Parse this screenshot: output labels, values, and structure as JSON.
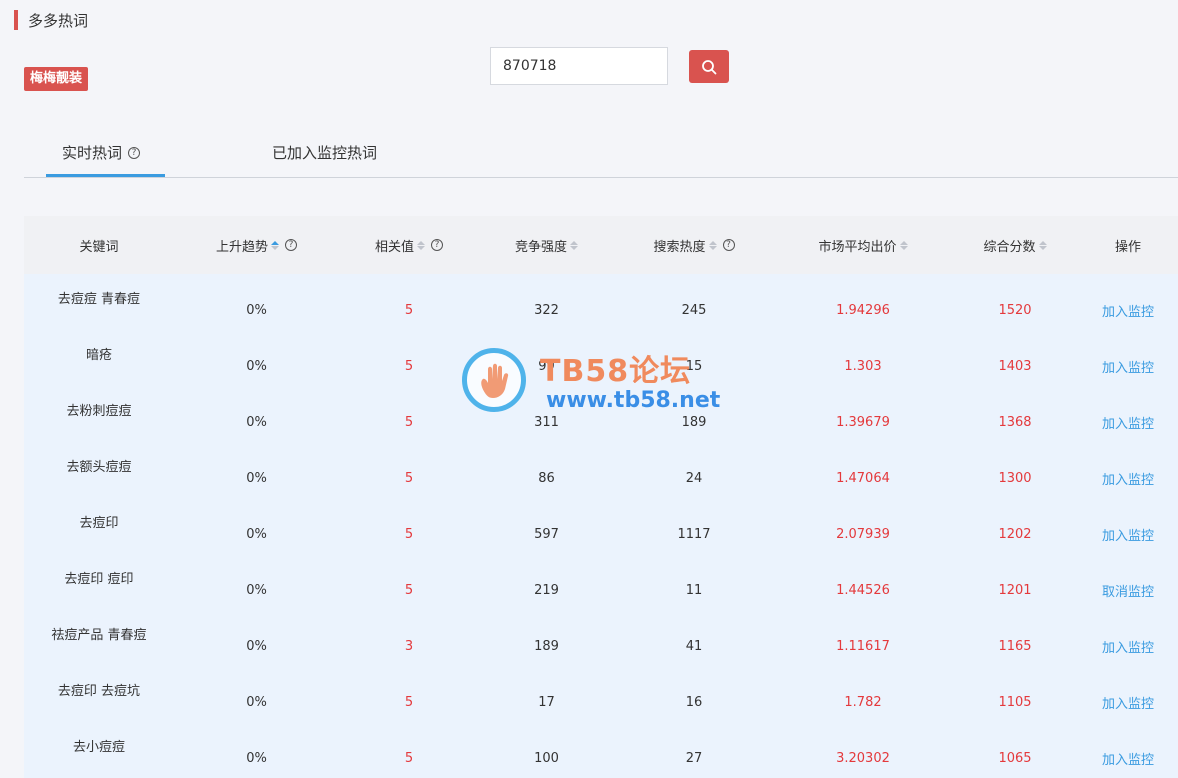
{
  "header": {
    "title": "多多热词"
  },
  "shop": {
    "name": "梅梅靓装"
  },
  "search": {
    "value": "870718"
  },
  "tabs": [
    {
      "label": "实时热词",
      "active": true
    },
    {
      "label": "已加入监控热词",
      "active": false
    }
  ],
  "table": {
    "headers": [
      "关键词",
      "上升趋势",
      "相关值",
      "竞争强度",
      "搜索热度",
      "市场平均出价",
      "综合分数",
      "操作"
    ],
    "rows": [
      {
        "keyword": "去痘痘 青春痘",
        "trend": "0%",
        "relevance": "5",
        "competition": "322",
        "heat": "245",
        "avg_bid": "1.94296",
        "score": "1520",
        "action": "加入监控"
      },
      {
        "keyword": "暗疮",
        "trend": "0%",
        "relevance": "5",
        "competition": "99",
        "heat": "15",
        "avg_bid": "1.303",
        "score": "1403",
        "action": "加入监控"
      },
      {
        "keyword": "去粉刺痘痘",
        "trend": "0%",
        "relevance": "5",
        "competition": "311",
        "heat": "189",
        "avg_bid": "1.39679",
        "score": "1368",
        "action": "加入监控"
      },
      {
        "keyword": "去额头痘痘",
        "trend": "0%",
        "relevance": "5",
        "competition": "86",
        "heat": "24",
        "avg_bid": "1.47064",
        "score": "1300",
        "action": "加入监控"
      },
      {
        "keyword": "去痘印",
        "trend": "0%",
        "relevance": "5",
        "competition": "597",
        "heat": "1117",
        "avg_bid": "2.07939",
        "score": "1202",
        "action": "加入监控"
      },
      {
        "keyword": "去痘印 痘印",
        "trend": "0%",
        "relevance": "5",
        "competition": "219",
        "heat": "11",
        "avg_bid": "1.44526",
        "score": "1201",
        "action": "取消监控"
      },
      {
        "keyword": "祛痘产品 青春痘",
        "trend": "0%",
        "relevance": "3",
        "competition": "189",
        "heat": "41",
        "avg_bid": "1.11617",
        "score": "1165",
        "action": "加入监控"
      },
      {
        "keyword": "去痘印 去痘坑",
        "trend": "0%",
        "relevance": "5",
        "competition": "17",
        "heat": "16",
        "avg_bid": "1.782",
        "score": "1105",
        "action": "加入监控"
      },
      {
        "keyword": "去小痘痘",
        "trend": "0%",
        "relevance": "5",
        "competition": "100",
        "heat": "27",
        "avg_bid": "3.20302",
        "score": "1065",
        "action": "加入监控"
      }
    ]
  },
  "watermark": {
    "title": "TB58论坛",
    "url": "www.tb58.net"
  },
  "colors": {
    "accent_red": "#d9534f",
    "value_red": "#e4393c",
    "link_blue": "#3a9be0",
    "row_bg": "#ebf3fd"
  }
}
